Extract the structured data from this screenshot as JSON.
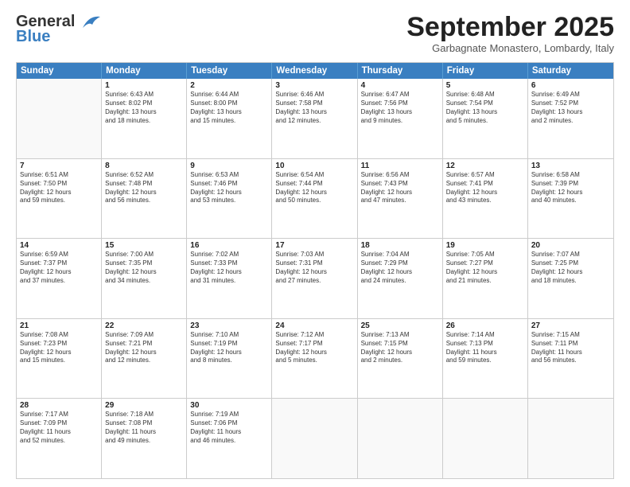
{
  "header": {
    "logo_line1": "General",
    "logo_line2": "Blue",
    "month": "September 2025",
    "location": "Garbagnate Monastero, Lombardy, Italy"
  },
  "days_of_week": [
    "Sunday",
    "Monday",
    "Tuesday",
    "Wednesday",
    "Thursday",
    "Friday",
    "Saturday"
  ],
  "weeks": [
    [
      {
        "day": "",
        "info": ""
      },
      {
        "day": "1",
        "info": "Sunrise: 6:43 AM\nSunset: 8:02 PM\nDaylight: 13 hours\nand 18 minutes."
      },
      {
        "day": "2",
        "info": "Sunrise: 6:44 AM\nSunset: 8:00 PM\nDaylight: 13 hours\nand 15 minutes."
      },
      {
        "day": "3",
        "info": "Sunrise: 6:46 AM\nSunset: 7:58 PM\nDaylight: 13 hours\nand 12 minutes."
      },
      {
        "day": "4",
        "info": "Sunrise: 6:47 AM\nSunset: 7:56 PM\nDaylight: 13 hours\nand 9 minutes."
      },
      {
        "day": "5",
        "info": "Sunrise: 6:48 AM\nSunset: 7:54 PM\nDaylight: 13 hours\nand 5 minutes."
      },
      {
        "day": "6",
        "info": "Sunrise: 6:49 AM\nSunset: 7:52 PM\nDaylight: 13 hours\nand 2 minutes."
      }
    ],
    [
      {
        "day": "7",
        "info": "Sunrise: 6:51 AM\nSunset: 7:50 PM\nDaylight: 12 hours\nand 59 minutes."
      },
      {
        "day": "8",
        "info": "Sunrise: 6:52 AM\nSunset: 7:48 PM\nDaylight: 12 hours\nand 56 minutes."
      },
      {
        "day": "9",
        "info": "Sunrise: 6:53 AM\nSunset: 7:46 PM\nDaylight: 12 hours\nand 53 minutes."
      },
      {
        "day": "10",
        "info": "Sunrise: 6:54 AM\nSunset: 7:44 PM\nDaylight: 12 hours\nand 50 minutes."
      },
      {
        "day": "11",
        "info": "Sunrise: 6:56 AM\nSunset: 7:43 PM\nDaylight: 12 hours\nand 47 minutes."
      },
      {
        "day": "12",
        "info": "Sunrise: 6:57 AM\nSunset: 7:41 PM\nDaylight: 12 hours\nand 43 minutes."
      },
      {
        "day": "13",
        "info": "Sunrise: 6:58 AM\nSunset: 7:39 PM\nDaylight: 12 hours\nand 40 minutes."
      }
    ],
    [
      {
        "day": "14",
        "info": "Sunrise: 6:59 AM\nSunset: 7:37 PM\nDaylight: 12 hours\nand 37 minutes."
      },
      {
        "day": "15",
        "info": "Sunrise: 7:00 AM\nSunset: 7:35 PM\nDaylight: 12 hours\nand 34 minutes."
      },
      {
        "day": "16",
        "info": "Sunrise: 7:02 AM\nSunset: 7:33 PM\nDaylight: 12 hours\nand 31 minutes."
      },
      {
        "day": "17",
        "info": "Sunrise: 7:03 AM\nSunset: 7:31 PM\nDaylight: 12 hours\nand 27 minutes."
      },
      {
        "day": "18",
        "info": "Sunrise: 7:04 AM\nSunset: 7:29 PM\nDaylight: 12 hours\nand 24 minutes."
      },
      {
        "day": "19",
        "info": "Sunrise: 7:05 AM\nSunset: 7:27 PM\nDaylight: 12 hours\nand 21 minutes."
      },
      {
        "day": "20",
        "info": "Sunrise: 7:07 AM\nSunset: 7:25 PM\nDaylight: 12 hours\nand 18 minutes."
      }
    ],
    [
      {
        "day": "21",
        "info": "Sunrise: 7:08 AM\nSunset: 7:23 PM\nDaylight: 12 hours\nand 15 minutes."
      },
      {
        "day": "22",
        "info": "Sunrise: 7:09 AM\nSunset: 7:21 PM\nDaylight: 12 hours\nand 12 minutes."
      },
      {
        "day": "23",
        "info": "Sunrise: 7:10 AM\nSunset: 7:19 PM\nDaylight: 12 hours\nand 8 minutes."
      },
      {
        "day": "24",
        "info": "Sunrise: 7:12 AM\nSunset: 7:17 PM\nDaylight: 12 hours\nand 5 minutes."
      },
      {
        "day": "25",
        "info": "Sunrise: 7:13 AM\nSunset: 7:15 PM\nDaylight: 12 hours\nand 2 minutes."
      },
      {
        "day": "26",
        "info": "Sunrise: 7:14 AM\nSunset: 7:13 PM\nDaylight: 11 hours\nand 59 minutes."
      },
      {
        "day": "27",
        "info": "Sunrise: 7:15 AM\nSunset: 7:11 PM\nDaylight: 11 hours\nand 56 minutes."
      }
    ],
    [
      {
        "day": "28",
        "info": "Sunrise: 7:17 AM\nSunset: 7:09 PM\nDaylight: 11 hours\nand 52 minutes."
      },
      {
        "day": "29",
        "info": "Sunrise: 7:18 AM\nSunset: 7:08 PM\nDaylight: 11 hours\nand 49 minutes."
      },
      {
        "day": "30",
        "info": "Sunrise: 7:19 AM\nSunset: 7:06 PM\nDaylight: 11 hours\nand 46 minutes."
      },
      {
        "day": "",
        "info": ""
      },
      {
        "day": "",
        "info": ""
      },
      {
        "day": "",
        "info": ""
      },
      {
        "day": "",
        "info": ""
      }
    ]
  ]
}
